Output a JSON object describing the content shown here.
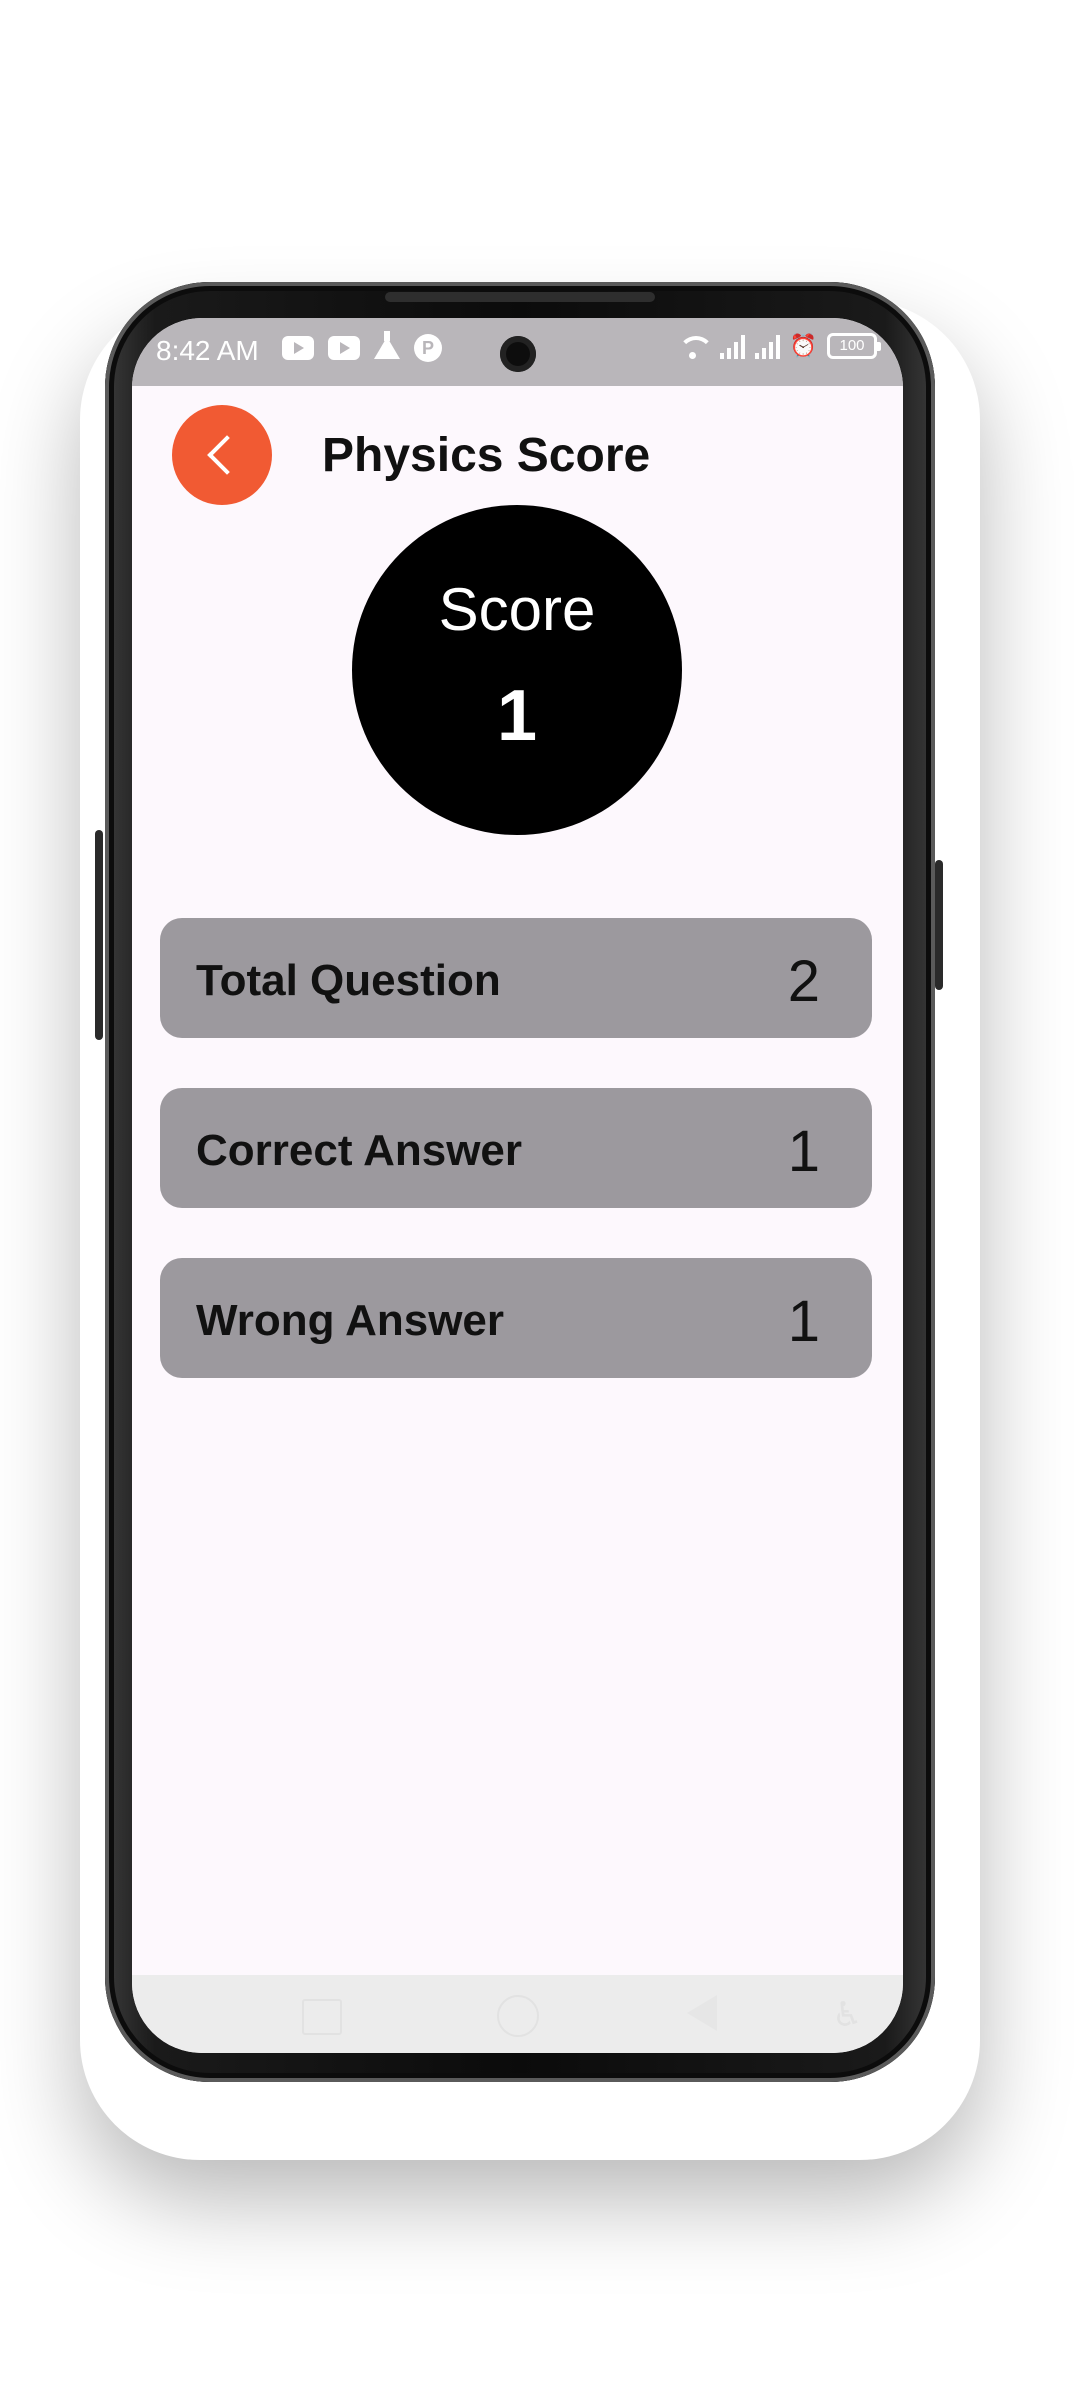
{
  "status_bar": {
    "time": "8:42 AM",
    "notification_icons": [
      "youtube-icon",
      "youtube-icon",
      "flask-icon",
      "app-circle-icon"
    ],
    "app_circle_letter": "P",
    "battery": "100"
  },
  "header": {
    "title": "Physics Score",
    "back_icon": "chevron-left-icon",
    "accent_color": "#f15a33"
  },
  "score": {
    "label": "Score",
    "value": "1"
  },
  "stats": [
    {
      "label": "Total Question",
      "value": "2"
    },
    {
      "label": "Correct Answer",
      "value": "1"
    },
    {
      "label": "Wrong Answer",
      "value": "1"
    }
  ],
  "colors": {
    "screen_background": "#fdf8fd",
    "card_background": "#9c999e",
    "score_circle": "#000000"
  },
  "nav_bar": {
    "icons": [
      "recent-apps-icon",
      "home-icon",
      "back-icon",
      "accessibility-icon"
    ]
  }
}
